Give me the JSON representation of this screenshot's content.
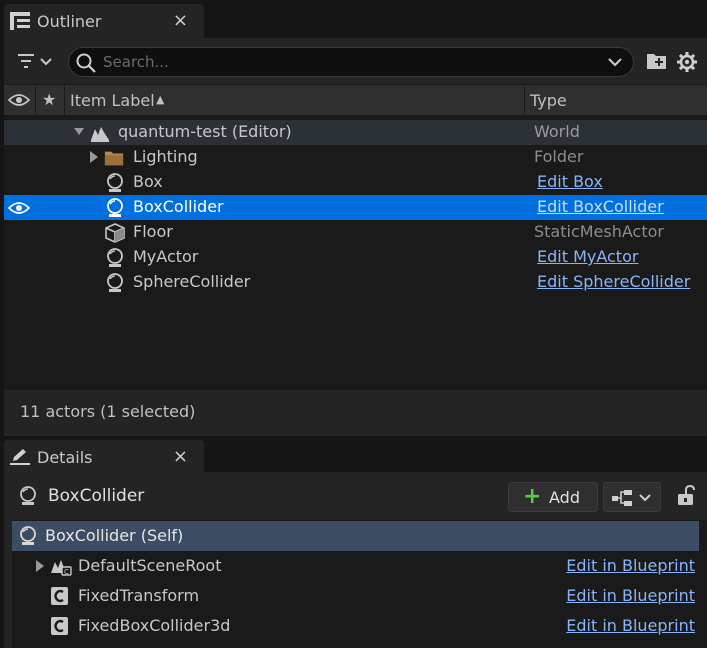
{
  "outliner": {
    "tab_title": "Outliner",
    "close_glyph": "×",
    "search_placeholder": "Search...",
    "columns": {
      "visibility_icon": "eye-icon",
      "pin_glyph": "★",
      "item_label": "Item Label",
      "sort_glyph": "▲",
      "type": "Type"
    },
    "rows": [
      {
        "label": "quantum-test (Editor)",
        "type": "World",
        "icon": "world-icon",
        "type_is_link": false
      },
      {
        "label": "Lighting",
        "type": "Folder",
        "icon": "folder-icon",
        "type_is_link": false
      },
      {
        "label": "Box",
        "type": "Edit Box",
        "icon": "actor-icon",
        "type_is_link": true
      },
      {
        "label": "BoxCollider",
        "type": "Edit BoxCollider",
        "icon": "actor-icon",
        "type_is_link": true,
        "selected": true
      },
      {
        "label": "Floor",
        "type": "StaticMeshActor",
        "icon": "static-mesh-icon",
        "type_is_link": false
      },
      {
        "label": "MyActor",
        "type": "Edit MyActor",
        "icon": "actor-icon",
        "type_is_link": true
      },
      {
        "label": "SphereCollider",
        "type": "Edit SphereCollider",
        "icon": "actor-icon",
        "type_is_link": true
      }
    ],
    "status": "11 actors (1 selected)"
  },
  "details": {
    "tab_title": "Details",
    "close_glyph": "×",
    "actor_name": "BoxCollider",
    "add_label": "Add",
    "add_glyph": "+",
    "components": [
      {
        "label": "BoxCollider (Self)",
        "link": ""
      },
      {
        "label": "DefaultSceneRoot",
        "link": "Edit in Blueprint"
      },
      {
        "label": "FixedTransform",
        "link": "Edit in Blueprint"
      },
      {
        "label": "FixedBoxCollider3d",
        "link": "Edit in Blueprint"
      }
    ]
  },
  "colors": {
    "selection": "#0070e0",
    "link": "#8ab4f8",
    "add_plus": "#5ac84a",
    "folder": "#b8894a"
  }
}
